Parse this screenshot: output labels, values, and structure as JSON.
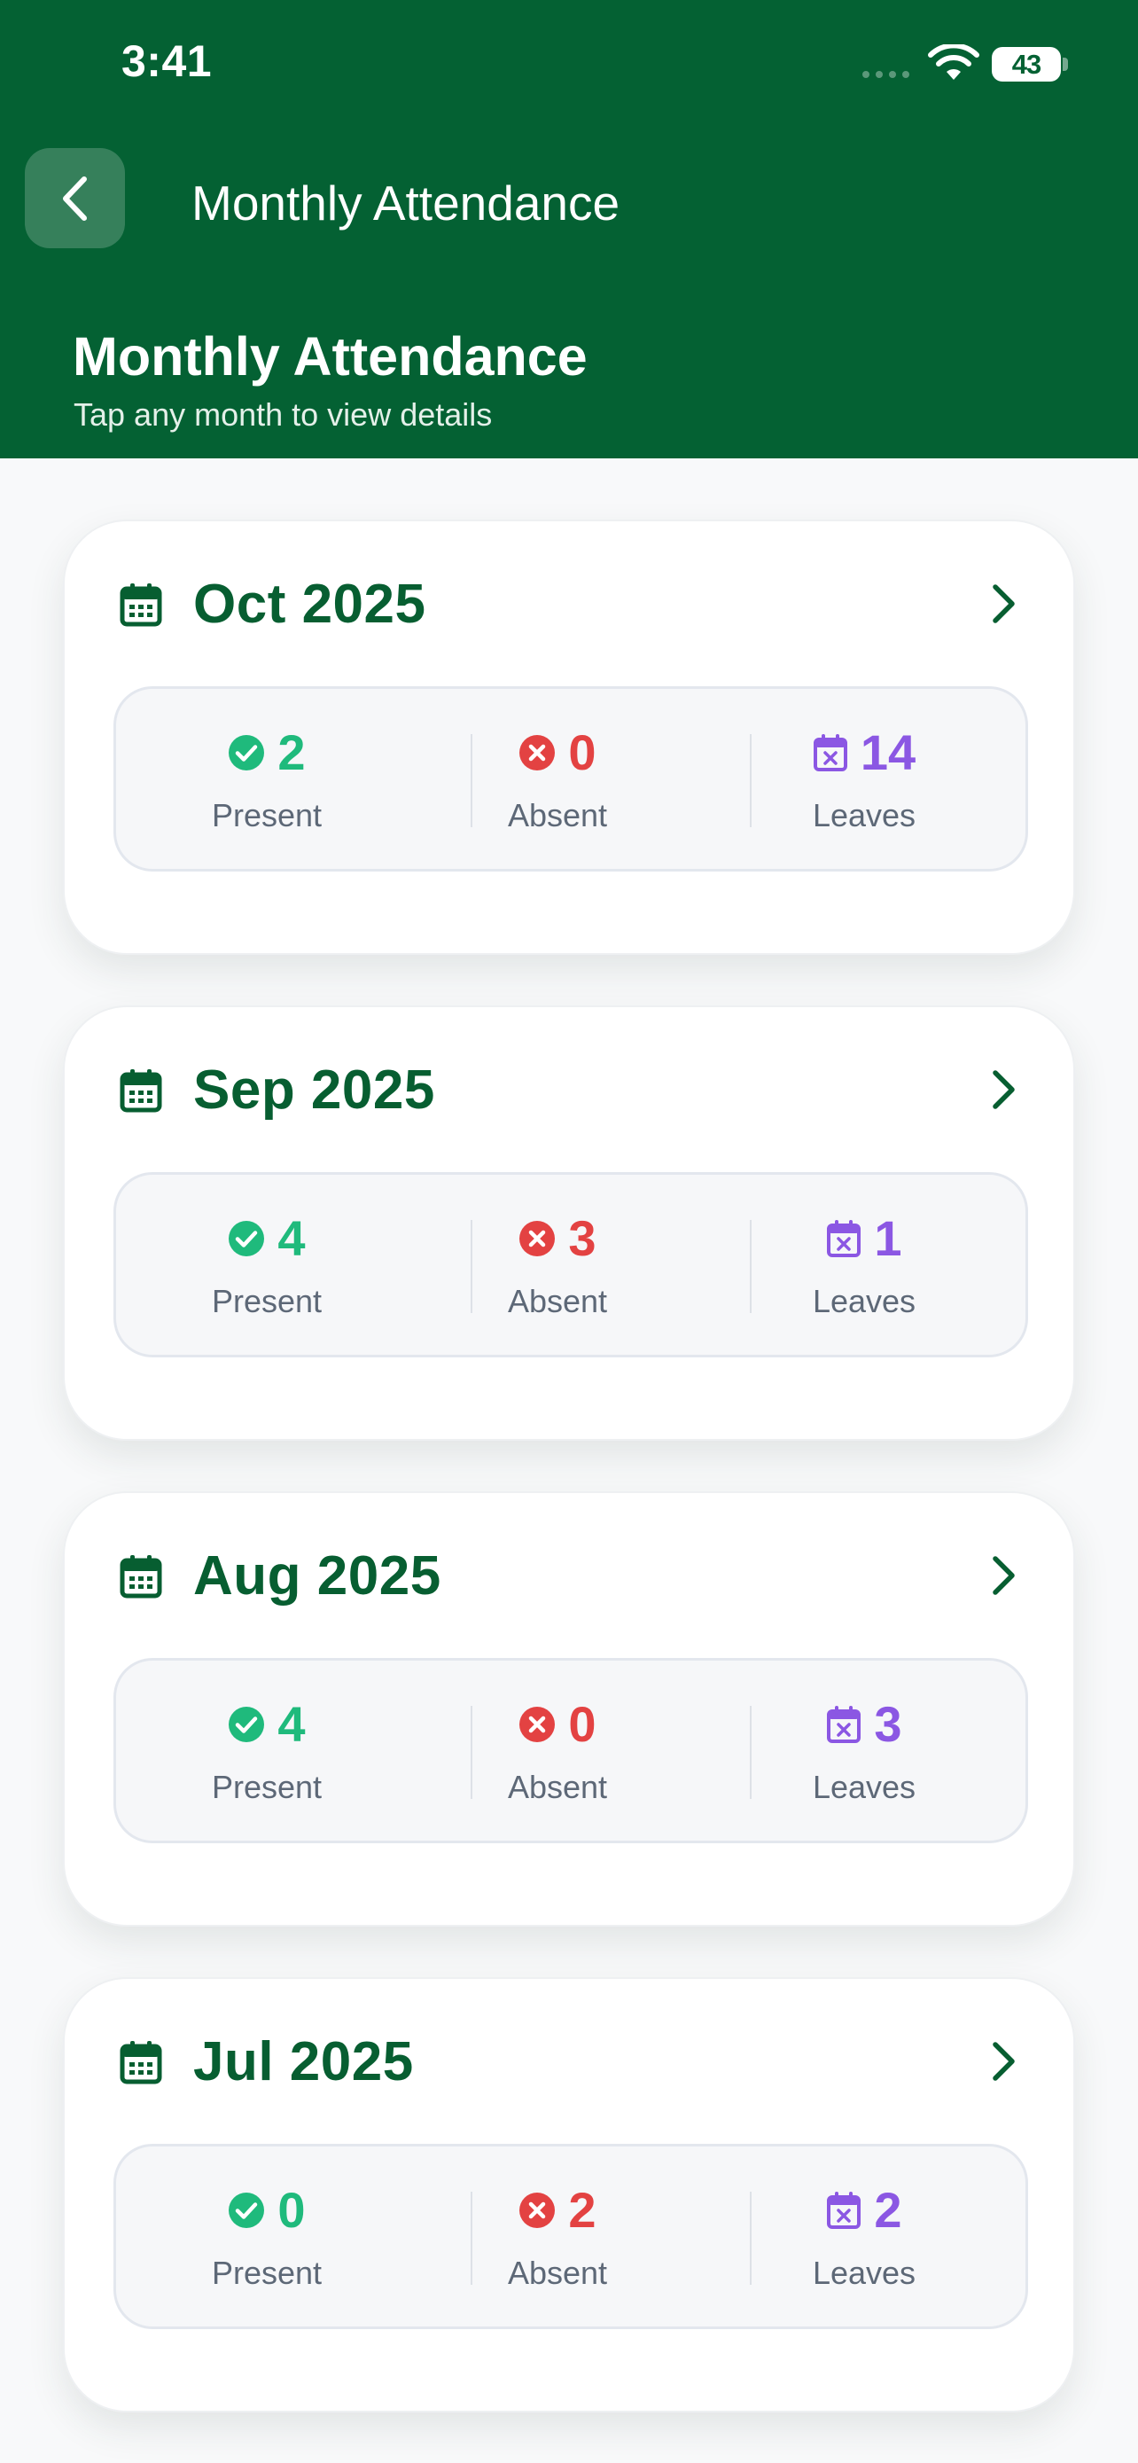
{
  "status_bar": {
    "time": "3:41",
    "battery": "43"
  },
  "nav": {
    "title": "Monthly Attendance"
  },
  "header": {
    "title": "Monthly Attendance",
    "subtitle": "Tap any month to view details"
  },
  "colors": {
    "brand": "#046133",
    "present": "#1fba7c",
    "absent": "#e34242",
    "leaves": "#8b57e3"
  },
  "labels": {
    "present": "Present",
    "absent": "Absent",
    "leaves": "Leaves"
  },
  "months": [
    {
      "label": "Oct 2025",
      "present": "2",
      "absent": "0",
      "leaves": "14"
    },
    {
      "label": "Sep 2025",
      "present": "4",
      "absent": "3",
      "leaves": "1"
    },
    {
      "label": "Aug 2025",
      "present": "4",
      "absent": "0",
      "leaves": "3"
    },
    {
      "label": "Jul 2025",
      "present": "0",
      "absent": "2",
      "leaves": "2"
    }
  ]
}
